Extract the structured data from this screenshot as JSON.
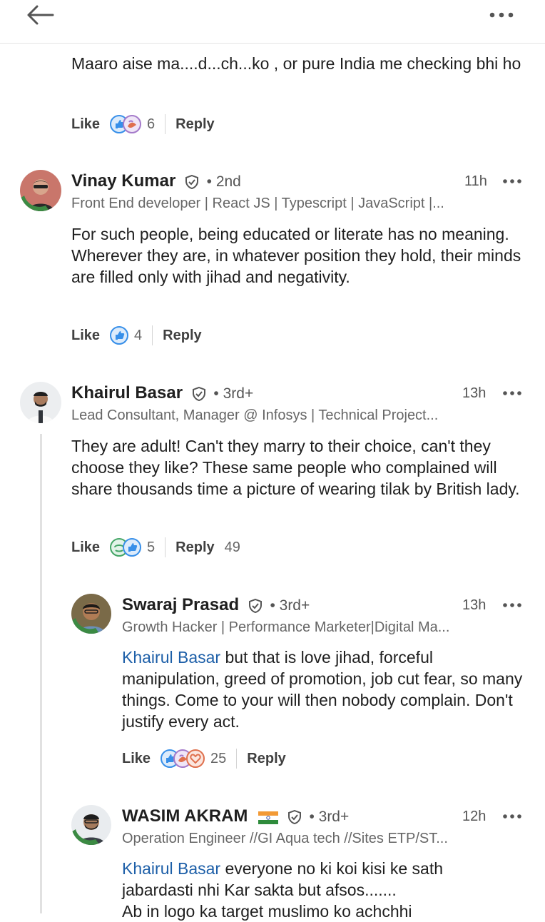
{
  "colors": {
    "mention": "#1d5fa8",
    "like_blue": "#378fe9",
    "celebrate_green": "#44a566",
    "love_red": "#df704d",
    "support_purple": "#a47aca"
  },
  "header": {
    "back_icon": "arrow-left-icon",
    "more_icon": "more-horizontal-icon"
  },
  "comments": [
    {
      "text": "Maaro aise ma....d...ch...ko , or pure India me checking bhi ho",
      "like_label": "Like",
      "reaction_count": "6",
      "reply_label": "Reply",
      "reactions": [
        "like",
        "support"
      ]
    },
    {
      "author": "Vinay Kumar",
      "degree": "• 2nd",
      "time": "11h",
      "headline": "Front End developer | React JS | Typescript | JavaScript |...",
      "text": "For such people, being educated or literate has no meaning. Wherever they are, in whatever position they hold, their minds are filled only with jihad and negativity.",
      "like_label": "Like",
      "reaction_count": "4",
      "reply_label": "Reply",
      "reactions": [
        "like"
      ]
    },
    {
      "author": "Khairul Basar",
      "degree": "• 3rd+",
      "time": "13h",
      "headline": "Lead Consultant, Manager @ Infosys | Technical Project...",
      "text": "They are adult! Can't they marry to their choice, can't they choose they like? These same people who complained will share thousands time a picture of wearing tilak by British lady.",
      "like_label": "Like",
      "reaction_count": "5",
      "reply_label": "Reply",
      "reply_count": "49",
      "reactions": [
        "celebrate",
        "like"
      ]
    },
    {
      "author": "Swaraj Prasad",
      "degree": "• 3rd+",
      "time": "13h",
      "headline": "Growth Hacker | Performance Marketer|Digital Ma...",
      "mention": "Khairul Basar",
      "text": " but that is love jihad, forceful manipulation, greed of promotion, job cut fear, so many things. Come to your will then nobody complain. Don't justify every act.",
      "like_label": "Like",
      "reaction_count": "25",
      "reply_label": "Reply",
      "reactions": [
        "like",
        "support",
        "love"
      ]
    },
    {
      "author": "WASIM AKRAM",
      "flag": "🇮🇳",
      "degree": "• 3rd+",
      "time": "12h",
      "headline": "Operation Engineer //GI Aqua tech //Sites ETP/ST...",
      "mention": "Khairul Basar",
      "text": " everyone no ki koi kisi ke sath jabardasti nhi Kar sakta but afsos.......",
      "text2": "Ab in logo ka target muslimo ko achchhi"
    }
  ]
}
